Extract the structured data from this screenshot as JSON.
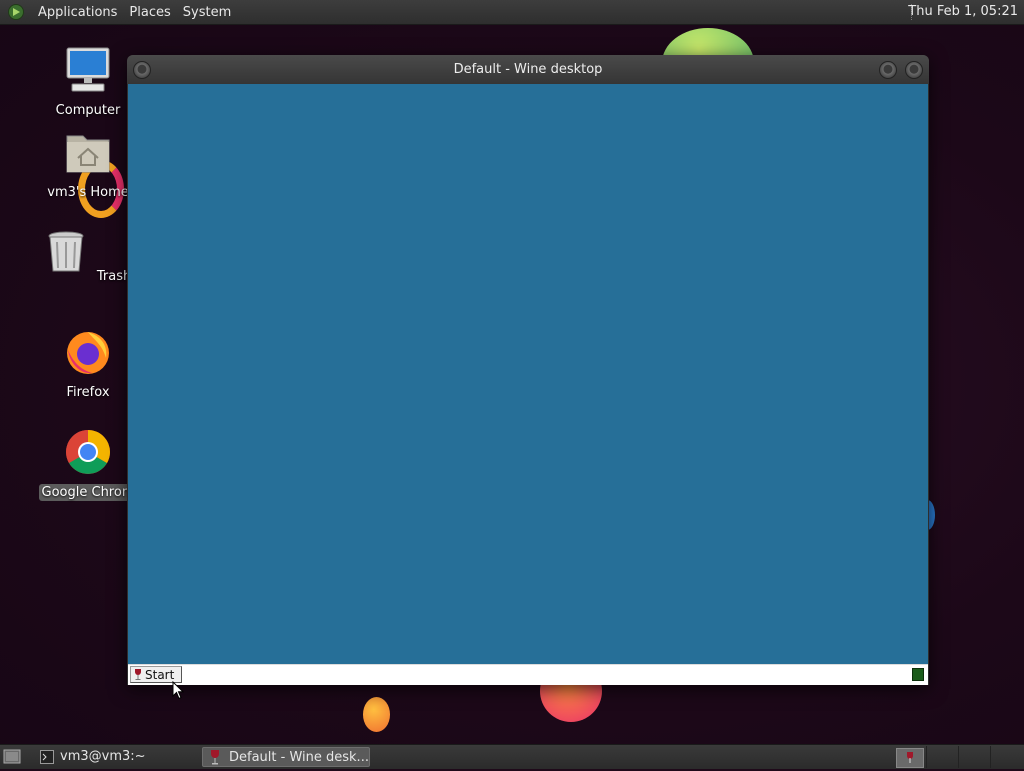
{
  "top_panel": {
    "menus": [
      "Applications",
      "Places",
      "System"
    ],
    "clock": "Thu Feb  1, 05:21"
  },
  "desktop_icons": [
    {
      "label": "Computer",
      "icon": "computer-icon"
    },
    {
      "label": "vm3's Home",
      "icon": "home-folder-icon"
    },
    {
      "label": "Trash",
      "icon": "trash-icon"
    },
    {
      "label": "Firefox",
      "icon": "firefox-icon"
    },
    {
      "label": "Google Chrom",
      "icon": "chrome-icon",
      "selected": true
    }
  ],
  "window": {
    "title": "Default - Wine desktop",
    "desktop_color": "#266f98",
    "taskbar": {
      "start_label": "Start"
    }
  },
  "bottom_panel": {
    "tasks": [
      {
        "label": "vm3@vm3:~",
        "icon": "terminal-icon",
        "active": false
      },
      {
        "label": "Default - Wine desk...",
        "icon": "wine-icon",
        "active": true
      }
    ]
  }
}
